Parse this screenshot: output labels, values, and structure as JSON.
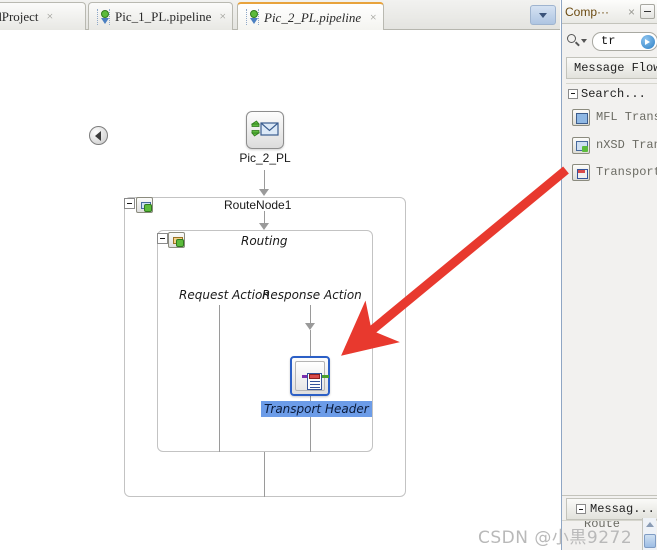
{
  "window": {
    "tabs": [
      {
        "label": "LoadProject",
        "active": false,
        "close": "×",
        "has_icon": false
      },
      {
        "label": "Pic_1_PL.pipeline",
        "active": false,
        "close": "×",
        "has_icon": true
      },
      {
        "label": "Pic_2_PL.pipeline",
        "active": true,
        "close": "×",
        "has_icon": true
      }
    ],
    "overflow_label": ""
  },
  "canvas": {
    "collapse_orb": "",
    "start_node": {
      "label": "Pic_2_PL",
      "icon": "message-envelope-icon"
    },
    "route_node": {
      "title": "RouteNode1",
      "toggle": "−",
      "icon": "route-node-icon"
    },
    "routing": {
      "title": "Routing",
      "toggle": "−",
      "icon": "routing-icon"
    },
    "request_action_label": "Request Action",
    "response_action_label": "Response Action",
    "transport_header_node": {
      "label": "Transport Header",
      "icon": "transport-header-icon",
      "selected": true
    }
  },
  "palette": {
    "title": "Comp···",
    "close": "×",
    "minimize": "",
    "search": {
      "value": "tr",
      "placeholder": "",
      "icon": "search-icon",
      "go_icon": "go-arrow-icon"
    },
    "section_message_flow": "Message Flow",
    "group_search": "Search...",
    "items": [
      {
        "label": "MFL Transl",
        "icon": "mfl-translate-icon"
      },
      {
        "label": "nXSD Transl",
        "icon": "nxsd-translate-icon"
      },
      {
        "label": "Transport H",
        "icon": "transport-header-icon"
      }
    ],
    "section_message_bottom": "Messag...",
    "bottom_ghost_label": "Route"
  },
  "annotation": {
    "arrow_color": "#e8392e",
    "type": "pointer-arrow"
  },
  "watermark": "CSDN @小黒9272"
}
